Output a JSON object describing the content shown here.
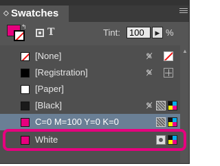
{
  "panel": {
    "title": "Swatches",
    "collapse_glyph": "◇",
    "menu_icon": "panel-menu-icon"
  },
  "toolbar": {
    "fill_color": "#e6007e",
    "type_glyph": "T",
    "tint_label": "Tint:",
    "tint_value": "100",
    "tint_arrow": "▶",
    "percent": "%"
  },
  "swatches": [
    {
      "name": "[None]",
      "color": "none"
    },
    {
      "name": "[Registration]",
      "color": "#000000"
    },
    {
      "name": "[Paper]",
      "color": "#ffffff"
    },
    {
      "name": "[Black]",
      "color": "#1a1a1a"
    },
    {
      "name": "C=0 M=100 Y=0 K=0",
      "color": "#e6007e",
      "selected": true
    },
    {
      "name": "White",
      "color": "#e6007e"
    }
  ],
  "colors": {
    "highlight": "#e6007e",
    "selected_row": "#6a7f95"
  }
}
